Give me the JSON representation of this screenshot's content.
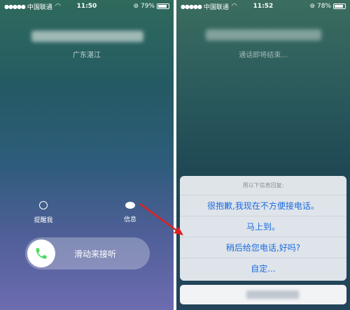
{
  "left": {
    "status": {
      "carrier": "中国联通",
      "time": "11:50",
      "battery": "79%"
    },
    "location": "广东湛江",
    "actions": {
      "remind_label": "提醒我",
      "message_label": "信息"
    },
    "slider_label": "滑动来接听"
  },
  "right": {
    "status": {
      "carrier": "中国联通",
      "time": "11:52",
      "battery": "78%"
    },
    "call_status": "通话即将结束...",
    "sheet": {
      "title": "用以下信息回复:",
      "options": [
        "很抱歉,我现在不方便接电话。",
        "马上到。",
        "稍后给您电话,好吗?",
        "自定..."
      ]
    }
  },
  "colors": {
    "accent": "#1b6be0",
    "arrow": "#e02020",
    "answer": "#4cd964"
  },
  "icons": [
    "wifi-icon",
    "alarm-icon",
    "message-icon",
    "phone-icon",
    "lock-icon"
  ]
}
